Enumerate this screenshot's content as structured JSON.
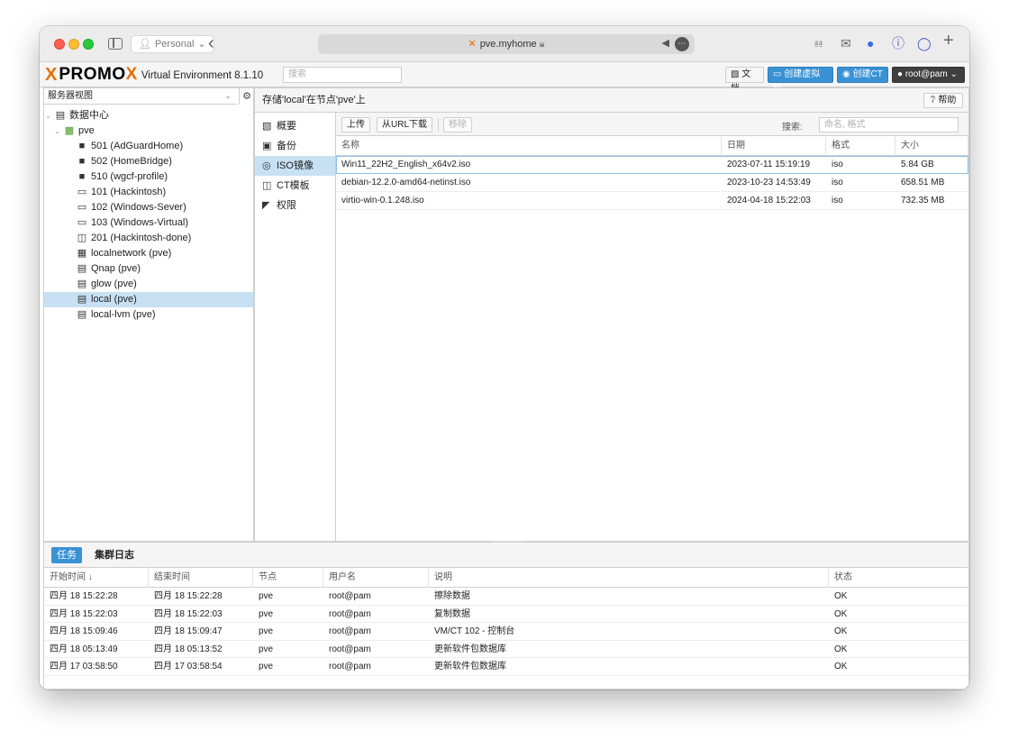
{
  "safari": {
    "profile": "Personal",
    "url": "pve.myhome"
  },
  "header": {
    "logo_x": "X",
    "logo_pro": "PRO",
    "logo_mo": "MO",
    "logo_version": "Virtual Environment 8.1.10",
    "search_placeholder": "搜索",
    "docs_label": "文档",
    "create_vm_label": "创建虚拟机",
    "create_ct_label": "创建CT",
    "user_label": "root@pam"
  },
  "tree": {
    "view_label": "服务器视图",
    "datacenter": "数据中心",
    "node": "pve",
    "items": [
      {
        "label": "501 (AdGuardHome)",
        "icon": "vm-running-icon"
      },
      {
        "label": "502 (HomeBridge)",
        "icon": "vm-running-icon"
      },
      {
        "label": "510 (wgcf-profile)",
        "icon": "vm-stopped-icon"
      },
      {
        "label": "101 (Hackintosh)",
        "icon": "vm-stopped-icon"
      },
      {
        "label": "102 (Windows-Sever)",
        "icon": "vm-running-icon"
      },
      {
        "label": "103 (Windows-Virtual)",
        "icon": "vm-running-icon"
      },
      {
        "label": "201 (Hackintosh-done)",
        "icon": "template-icon"
      },
      {
        "label": "localnetwork (pve)",
        "icon": "network-icon"
      },
      {
        "label": "Qnap (pve)",
        "icon": "storage-icon"
      },
      {
        "label": "glow (pve)",
        "icon": "storage-icon"
      },
      {
        "label": "local (pve)",
        "icon": "storage-icon"
      },
      {
        "label": "local-lvm (pve)",
        "icon": "storage-icon"
      }
    ]
  },
  "panel": {
    "title": "存储'local'在节点'pve'上",
    "help_label": "帮助",
    "menu": [
      "概要",
      "备份",
      "ISO镜像",
      "CT模板",
      "权限"
    ]
  },
  "toolbar": {
    "upload": "上传",
    "download_url": "从URL下载",
    "remove": "移除",
    "search_label": "搜索:",
    "search_placeholder": "命名, 格式"
  },
  "iso_table": {
    "columns": [
      "名称",
      "日期",
      "格式",
      "大小"
    ],
    "rows": [
      {
        "name": "Win11_22H2_English_x64v2.iso",
        "date": "2023-07-11 15:19:19",
        "format": "iso",
        "size": "5.84 GB"
      },
      {
        "name": "debian-12.2.0-amd64-netinst.iso",
        "date": "2023-10-23 14:53:49",
        "format": "iso",
        "size": "658.51 MB"
      },
      {
        "name": "virtio-win-0.1.248.iso",
        "date": "2024-04-18 15:22:03",
        "format": "iso",
        "size": "732.35 MB"
      }
    ]
  },
  "tasks": {
    "tab_tasks": "任务",
    "tab_cluster_log": "集群日志",
    "columns": [
      "开始时间 ↓",
      "结束时间",
      "节点",
      "用户名",
      "说明",
      "状态"
    ],
    "rows": [
      {
        "start": "四月 18 15:22:28",
        "end": "四月 18 15:22:28",
        "node": "pve",
        "user": "root@pam",
        "desc": "擦除数据",
        "status": "OK"
      },
      {
        "start": "四月 18 15:22:03",
        "end": "四月 18 15:22:03",
        "node": "pve",
        "user": "root@pam",
        "desc": "复制数据",
        "status": "OK"
      },
      {
        "start": "四月 18 15:09:46",
        "end": "四月 18 15:09:47",
        "node": "pve",
        "user": "root@pam",
        "desc": "VM/CT 102 - 控制台",
        "status": "OK"
      },
      {
        "start": "四月 18 05:13:49",
        "end": "四月 18 05:13:52",
        "node": "pve",
        "user": "root@pam",
        "desc": "更新软件包数据库",
        "status": "OK"
      },
      {
        "start": "四月 17 03:58:50",
        "end": "四月 17 03:58:54",
        "node": "pve",
        "user": "root@pam",
        "desc": "更新软件包数据库",
        "status": "OK"
      }
    ]
  }
}
